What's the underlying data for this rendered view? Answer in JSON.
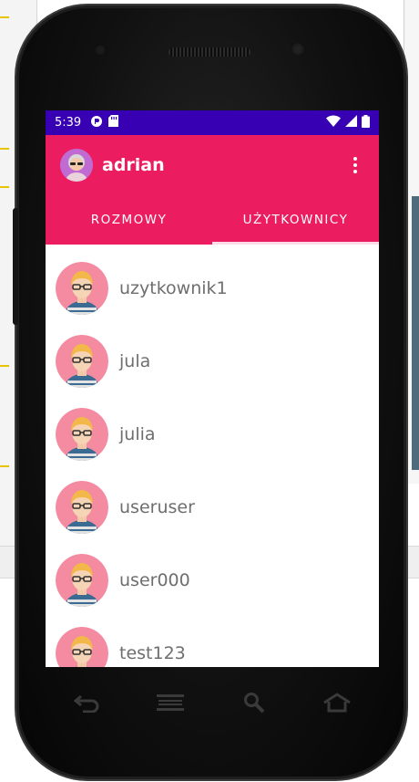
{
  "status_bar": {
    "time": "5:39"
  },
  "app_bar": {
    "title": "adrian"
  },
  "tabs": [
    {
      "label": "ROZMOWY",
      "selected": false
    },
    {
      "label": "UŻYTKOWNICY",
      "selected": true
    }
  ],
  "users": [
    {
      "name": "uzytkownik1"
    },
    {
      "name": "jula"
    },
    {
      "name": "julia"
    },
    {
      "name": "useruser"
    },
    {
      "name": "user000"
    },
    {
      "name": "test123"
    }
  ],
  "colors": {
    "status_bar": "#3700b3",
    "app_bar": "#ec1c61",
    "avatar_bg": "#f48ba1",
    "text_secondary": "#6e6e6e"
  },
  "icons": {
    "status_left": [
      "data-saver-icon",
      "sd-card-icon"
    ],
    "status_right": [
      "wifi-icon",
      "signal-icon",
      "battery-icon"
    ],
    "navigation": [
      "back-icon",
      "menu-lines-icon",
      "search-icon",
      "home-icon"
    ]
  }
}
